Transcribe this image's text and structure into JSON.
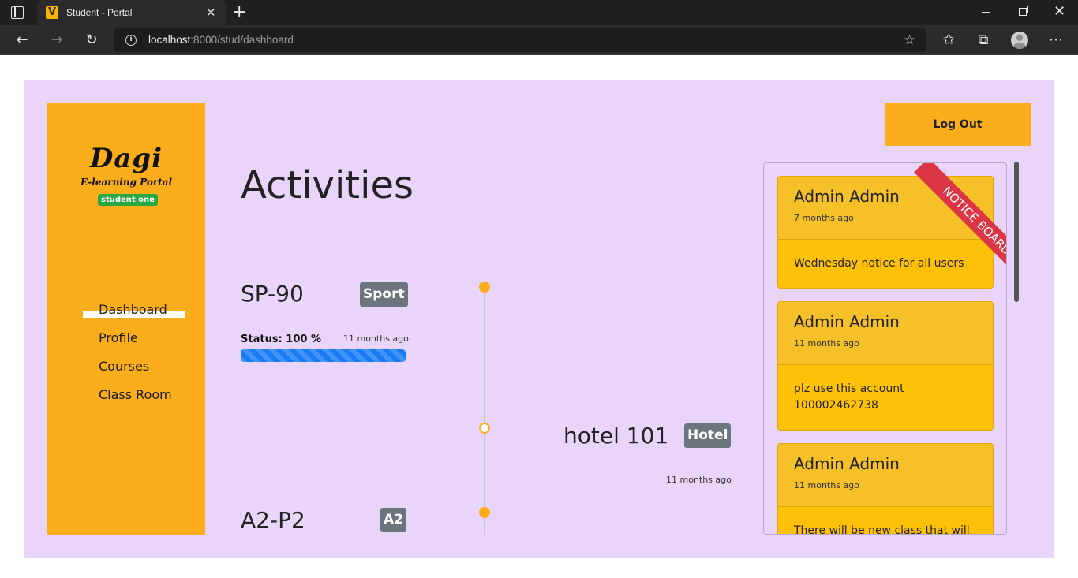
{
  "browser": {
    "tab_title": "Student - Portal",
    "favicon_glyph": "V",
    "url_host": "localhost",
    "url_path": ":8000/stud/dashboard",
    "icons": {
      "tab_actions": "tab-actions-icon",
      "close_tab": "close-icon",
      "new_tab": "plus-icon",
      "back": "arrow-left-icon",
      "forward": "arrow-right-icon",
      "refresh": "refresh-icon",
      "site_info": "info-icon",
      "add_favorite": "star-plus-icon",
      "favorites": "favorites-icon",
      "collections": "collections-icon",
      "profile": "avatar-icon",
      "menu": "more-icon"
    }
  },
  "sidebar": {
    "logo_main": "Dagi",
    "logo_sub": "E-learning Portal",
    "user_badge": "student one",
    "nav": [
      {
        "label": "Dashboard",
        "active": true
      },
      {
        "label": "Profile"
      },
      {
        "label": "Courses"
      },
      {
        "label": "Class Room"
      }
    ]
  },
  "main": {
    "heading": "Activities",
    "activities": [
      {
        "name": "SP-90",
        "badge": "Sport",
        "status_label": "Status: 100 %",
        "progress": 100,
        "time": "11 months ago"
      },
      {
        "name": "hotel 101",
        "badge": "Hotel",
        "time": "11 months ago"
      },
      {
        "name": "A2-P2",
        "badge": "A2"
      }
    ]
  },
  "header": {
    "logout_label": "Log Out"
  },
  "notice_board": {
    "ribbon_label": "NOTICE BOARD",
    "notices": [
      {
        "author": "Admin Admin",
        "time": "7 months ago",
        "body": "Wednesday notice for all users"
      },
      {
        "author": "Admin Admin",
        "time": "11 months ago",
        "body": "plz use this account 100002462738"
      },
      {
        "author": "Admin Admin",
        "time": "11 months ago",
        "body": "There will be new class that will"
      }
    ]
  },
  "colors": {
    "accent": "#fcad1b",
    "page_background": "#e9d5fa",
    "notice_card": "#ffc107",
    "ribbon": "#dc3545",
    "badge": "#6c757d",
    "progress": "#1a7cf5",
    "user_badge": "#28a745"
  }
}
